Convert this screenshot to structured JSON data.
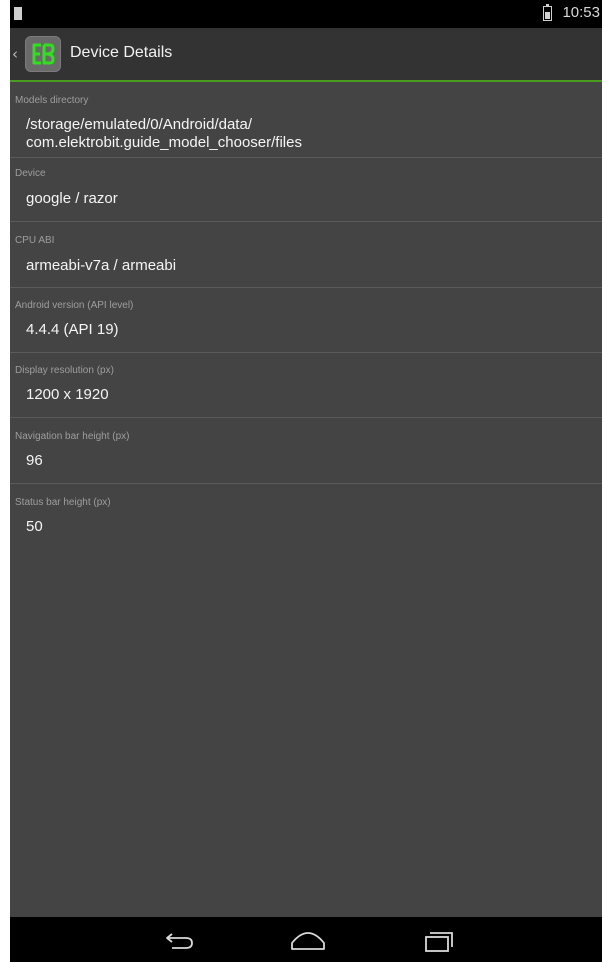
{
  "status_bar": {
    "time": "10:53",
    "notification_icon": "notification-icon",
    "battery_icon": "battery-icon"
  },
  "action_bar": {
    "title": "Device Details",
    "up_icon": "chevron-left-icon",
    "app_icon": "app-logo-icon",
    "app_icon_color": "#33dd22",
    "accent_color": "#4a9c1e"
  },
  "details": [
    {
      "label": "Models directory",
      "value": "/storage/emulated/0/Android/data/\ncom.elektrobit.guide_model_chooser/files"
    },
    {
      "label": "Device",
      "value": "google / razor"
    },
    {
      "label": "CPU ABI",
      "value": "armeabi-v7a / armeabi"
    },
    {
      "label": "Android version (API level)",
      "value": "4.4.4 (API 19)"
    },
    {
      "label": "Display resolution (px)",
      "value": "1200 x 1920"
    },
    {
      "label": "Navigation bar height (px)",
      "value": "96"
    },
    {
      "label": "Status bar height (px)",
      "value": "50"
    }
  ],
  "nav_bar": {
    "back_icon": "back-icon",
    "home_icon": "home-icon",
    "recents_icon": "recents-icon"
  }
}
